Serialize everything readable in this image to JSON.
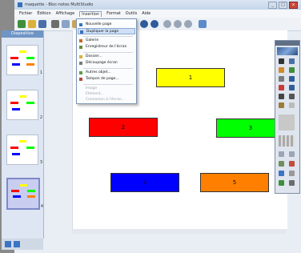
{
  "window": {
    "title": "maquette - Bloc-notes MultiStudio",
    "buttons": {
      "minimize": "_",
      "maximize": "□",
      "close": "x"
    }
  },
  "menubar": {
    "items": [
      "Fichier",
      "Édition",
      "Affichage",
      "Insertion",
      "Format",
      "Outils",
      "Aide"
    ]
  },
  "sidebar": {
    "title": "Diapositive",
    "pages": [
      "1",
      "2",
      "3",
      "4"
    ]
  },
  "dropdown": {
    "items": [
      {
        "label": "Nouvelle page"
      },
      {
        "label": "Dupliquer la page"
      },
      {
        "label": "Galerie"
      },
      {
        "label": "Enregistreur de l'écran"
      },
      {
        "label": "Dossier..."
      },
      {
        "label": "Découpage écran"
      },
      {
        "label": "Autres objet..."
      },
      {
        "label": "Tampon de page..."
      },
      {
        "label": "Image"
      },
      {
        "label": "Elément..."
      },
      {
        "label": "Connexion à l'écran..."
      }
    ]
  },
  "canvas": {
    "shapes": [
      {
        "label": "1",
        "color": "#ffff00"
      },
      {
        "label": "2",
        "color": "#ff0000"
      },
      {
        "label": "3",
        "color": "#00ff00"
      },
      {
        "label": "4",
        "color": "#0000ff"
      },
      {
        "label": "5",
        "color": "#ff8000"
      }
    ]
  },
  "icons": {
    "toolbar": [
      "new-icon",
      "open-icon",
      "save-icon",
      "cut-icon",
      "copy-icon",
      "paste-icon",
      "undo-icon",
      "redo-icon",
      "zoom-in-icon",
      "zoom-out-icon",
      "zoom-fit-icon",
      "screen-icon"
    ]
  },
  "colors": {
    "accent": "#6f95c5",
    "selection": "#c9cdf0"
  }
}
